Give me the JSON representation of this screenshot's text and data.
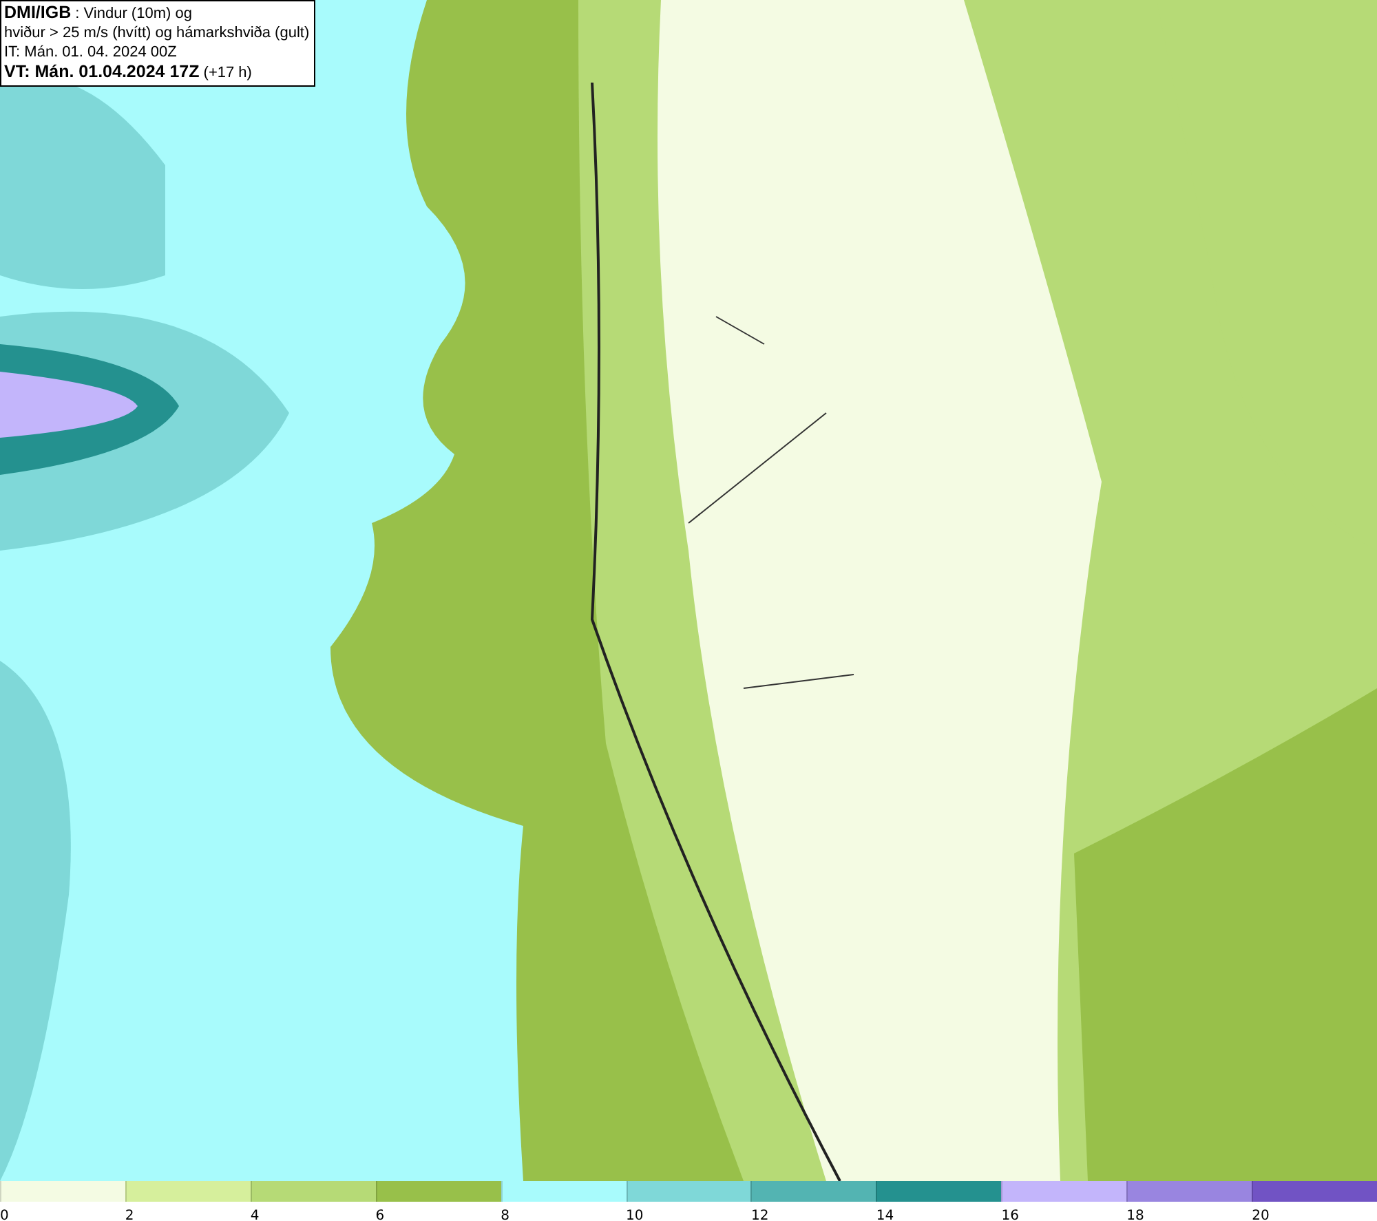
{
  "info_box": {
    "lines": [
      "**DMI/IGB** : Vindur (10m) og",
      "hviður > 25 m/s (hvítt) og hámarkshviða (gult)",
      "IT: Mán. 01. 04. 2024 00Z",
      "**VT: Mán. 01.04.2024 17Z** (+17 h)"
    ]
  },
  "legend": {
    "bins": [
      {
        "color": "#f4fbe3"
      },
      {
        "color": "#d6ef9c"
      },
      {
        "color": "#b6da76"
      },
      {
        "color": "#98c04a"
      },
      {
        "color": "#a8fbfc"
      },
      {
        "color": "#7fd8d8"
      },
      {
        "color": "#53b4b2"
      },
      {
        "color": "#24918f"
      },
      {
        "color": "#c3b5fb"
      },
      {
        "color": "#9985e0"
      },
      {
        "color": "#7153c4"
      }
    ],
    "ticks": [
      "0",
      "2",
      "4",
      "6",
      "8",
      "10",
      "12",
      "14",
      "16",
      "18",
      "20"
    ]
  }
}
